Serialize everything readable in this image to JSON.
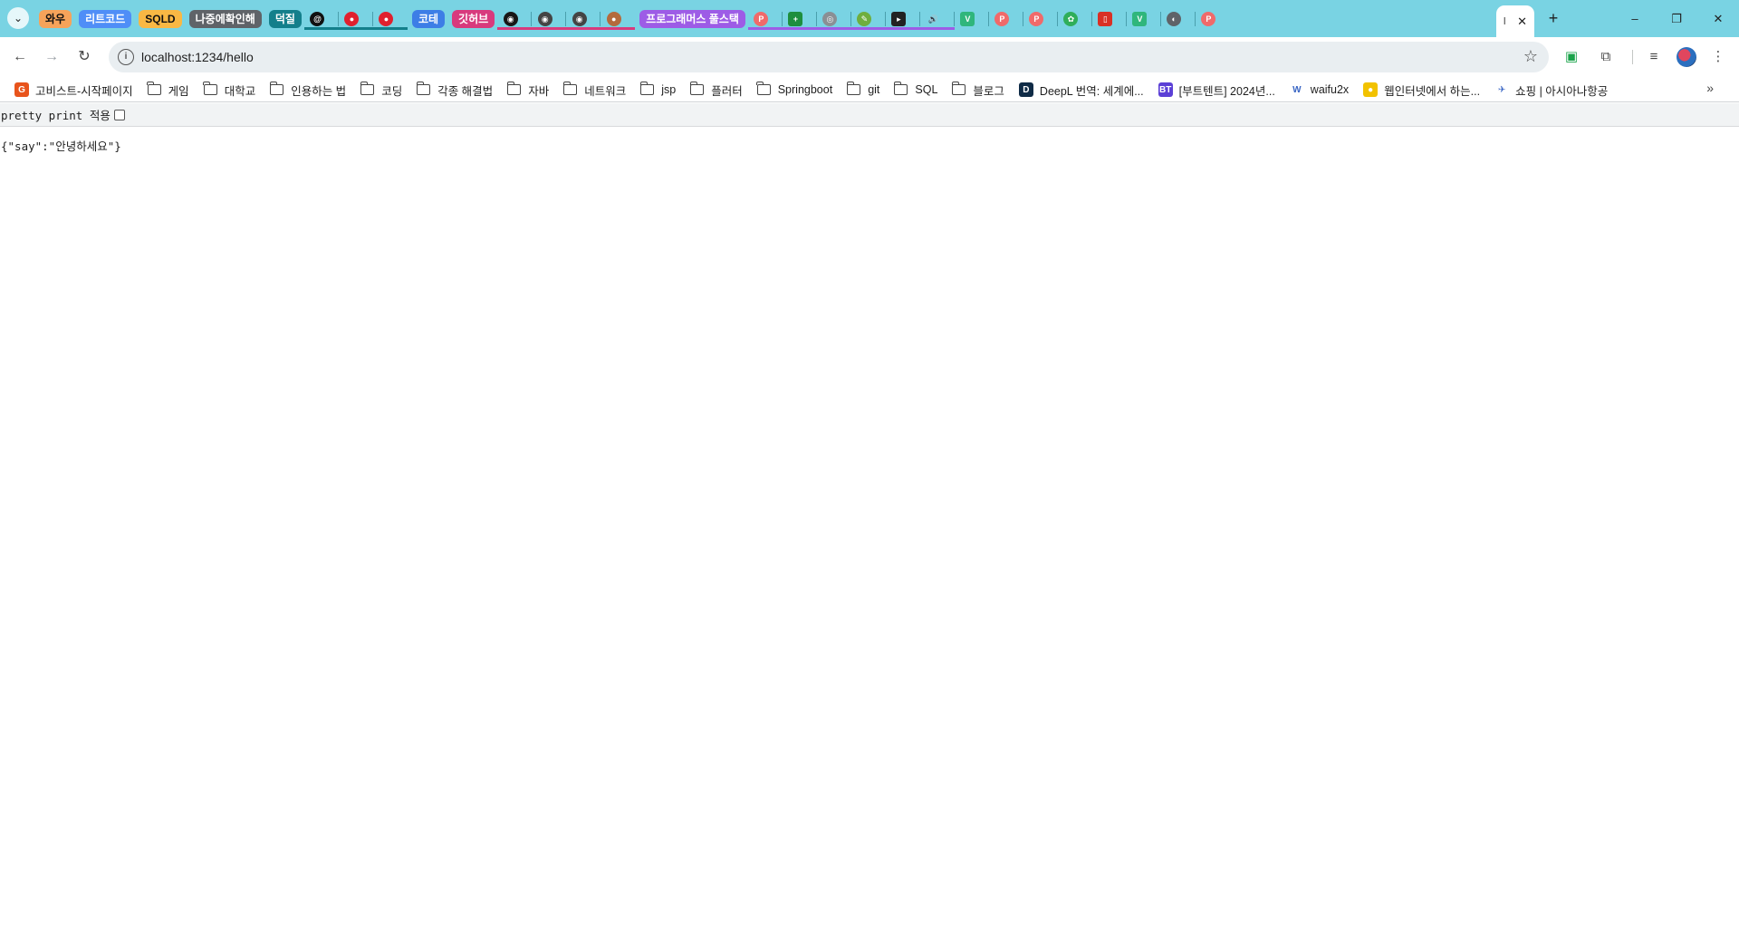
{
  "browser": {
    "tab_groups": [
      {
        "label": "와우",
        "color": "#f6a35a",
        "text_light": false
      },
      {
        "label": "리트코드",
        "color": "#4f8ef7",
        "text_light": true
      },
      {
        "label": "SQLD",
        "color": "#f9b844",
        "text_light": false
      },
      {
        "label": "나중에확인해",
        "color": "#5f6368",
        "text_light": true
      },
      {
        "label": "덕질",
        "color": "#137f8b",
        "text_light": true
      },
      {
        "label": "코테",
        "color": "#3d7ee6",
        "text_light": true
      },
      {
        "label": "깃허브",
        "color": "#d83a7d",
        "text_light": true
      },
      {
        "label": "프로그래머스 풀스택",
        "color": "#9d5ce6",
        "text_light": true
      }
    ],
    "active_tab_title": "l",
    "new_tab_symbol": "+",
    "window_controls": {
      "minimize": "–",
      "restore": "❐",
      "close": "✕"
    }
  },
  "toolbar": {
    "url": "localhost:1234/hello"
  },
  "bookmarks": [
    {
      "label": "고비스트-시작페이지",
      "type": "site",
      "icon": "gobist-icon",
      "color": "#e8541c",
      "glyph": "G"
    },
    {
      "label": "게임",
      "type": "folder"
    },
    {
      "label": "대학교",
      "type": "folder"
    },
    {
      "label": "인용하는 법",
      "type": "folder"
    },
    {
      "label": "코딩",
      "type": "folder"
    },
    {
      "label": "각종 해결법",
      "type": "folder"
    },
    {
      "label": "자바",
      "type": "folder"
    },
    {
      "label": "네트워크",
      "type": "folder"
    },
    {
      "label": "jsp",
      "type": "folder"
    },
    {
      "label": "플러터",
      "type": "folder"
    },
    {
      "label": "Springboot",
      "type": "folder"
    },
    {
      "label": "git",
      "type": "folder"
    },
    {
      "label": "SQL",
      "type": "folder"
    },
    {
      "label": "블로그",
      "type": "folder"
    },
    {
      "label": "DeepL 번역: 세계에...",
      "type": "site",
      "icon": "deepl-icon",
      "color": "#0f2b46",
      "glyph": "D"
    },
    {
      "label": "[부트텐트] 2024년...",
      "type": "site",
      "icon": "boottent-icon",
      "color": "#5b3fd6",
      "glyph": "BT"
    },
    {
      "label": "waifu2x",
      "type": "site",
      "icon": "waifu2x-icon",
      "color": "#ffffff",
      "glyph": "W"
    },
    {
      "label": "웹인터넷에서 하는...",
      "type": "site",
      "icon": "webinternet-icon",
      "color": "#f2c200",
      "glyph": "●"
    },
    {
      "label": "쇼핑 | 아시아나항공",
      "type": "site",
      "icon": "asiana-icon",
      "color": "#ffffff",
      "glyph": "✈"
    }
  ],
  "page": {
    "pretty_print_label": "pretty print 적용",
    "pretty_print_checked": false,
    "json_text": "{\"say\":\"안녕하세요\"}"
  }
}
